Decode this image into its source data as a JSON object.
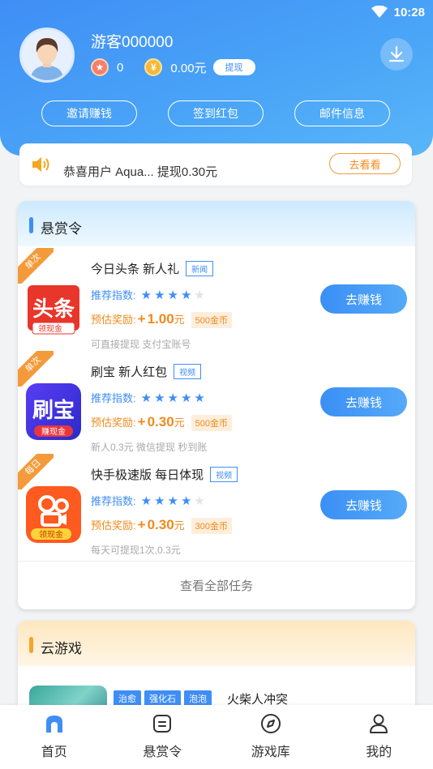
{
  "status": {
    "time": "10:28",
    "wifi_icon": "wifi-icon"
  },
  "profile": {
    "username": "游客000000",
    "points": "0",
    "balance": "0.00元",
    "withdraw_label": "提现"
  },
  "actions": [
    {
      "label": "邀请赚钱"
    },
    {
      "label": "签到红包"
    },
    {
      "label": "邮件信息"
    }
  ],
  "notice": {
    "text": "恭喜用户 Aqua... 提现0.30元",
    "button": "去看看"
  },
  "bounty": {
    "title": "悬赏令",
    "rec_label": "推荐指数:",
    "reward_label": "预估奖励:",
    "earn_label": "去赚钱",
    "view_all": "查看全部任务",
    "tasks": [
      {
        "ribbon": "单次",
        "name": "今日头条 新人礼",
        "tag": "新闻",
        "stars": 4,
        "amount_prefix": "+",
        "amount": "1.00",
        "unit": "元",
        "coins": "500金币",
        "desc": "可直接提现 支付宝账号",
        "icon_text": "头条",
        "icon_sub": "领现金"
      },
      {
        "ribbon": "单次",
        "name": "刷宝 新人红包",
        "tag": "视频",
        "stars": 5,
        "amount_prefix": "+",
        "amount": "0.30",
        "unit": "元",
        "coins": "500金币",
        "desc": "新人0.3元 微信提现 秒到账",
        "icon_text": "刷宝",
        "icon_sub": "赚现金"
      },
      {
        "ribbon": "每日",
        "name": "快手极速版 每日体现",
        "tag": "视频",
        "stars": 4,
        "amount_prefix": "+",
        "amount": "0.30",
        "unit": "元",
        "coins": "300金币",
        "desc": "每天可提现1次,0.3元",
        "icon_text": "",
        "icon_sub": "领现金"
      }
    ]
  },
  "cloud_game": {
    "title": "云游戏",
    "tags": [
      "治愈",
      "强化石",
      "泡泡"
    ],
    "name": "火柴人冲突"
  },
  "nav": [
    {
      "label": "首页",
      "icon": "home-icon",
      "active": true
    },
    {
      "label": "悬赏令",
      "icon": "task-list-icon",
      "active": false
    },
    {
      "label": "游戏库",
      "icon": "compass-icon",
      "active": false
    },
    {
      "label": "我的",
      "icon": "user-icon",
      "active": false
    }
  ],
  "colors": {
    "primary": "#3f8ef5",
    "accent_orange": "#f08a1c",
    "ribbon": "#f49a3a"
  }
}
